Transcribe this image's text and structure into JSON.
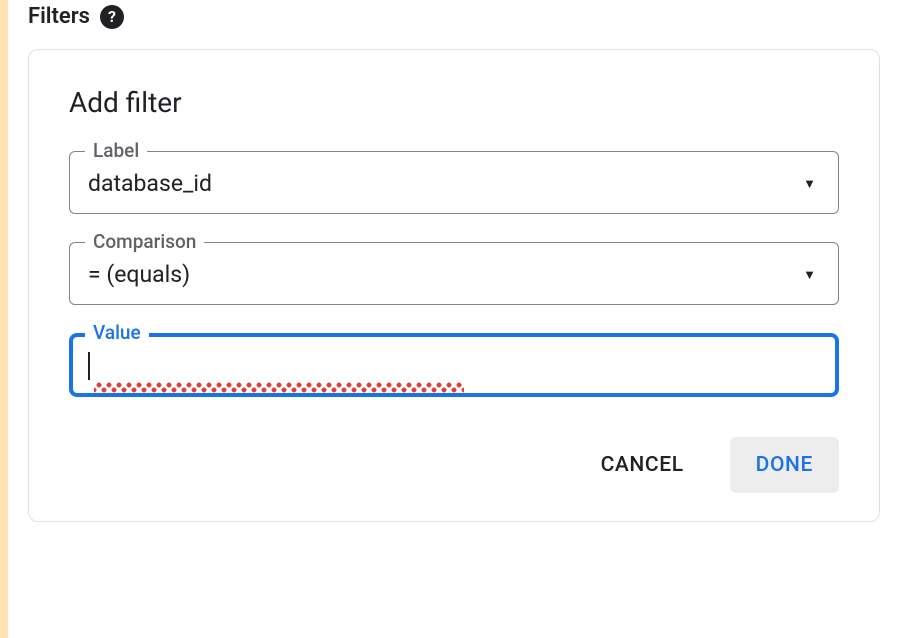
{
  "header": {
    "title": "Filters",
    "help_glyph": "?"
  },
  "card": {
    "title": "Add filter",
    "label_field": {
      "legend": "Label",
      "value": "database_id"
    },
    "comparison_field": {
      "legend": "Comparison",
      "value": "= (equals)"
    },
    "value_field": {
      "legend": "Value",
      "value_redacted": true
    },
    "buttons": {
      "cancel": "CANCEL",
      "done": "DONE"
    }
  }
}
